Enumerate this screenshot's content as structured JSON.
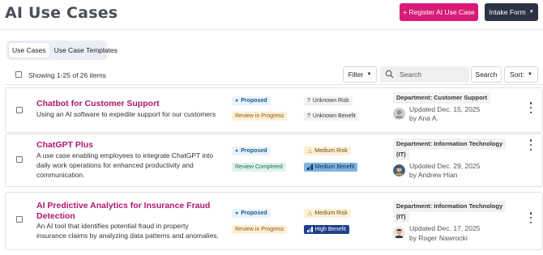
{
  "page": {
    "title": "AI Use Cases",
    "register_label": "+ Register AI Use Case",
    "intake_label": "Intake Form"
  },
  "tabs": [
    "Use Cases",
    "Use Case Templates"
  ],
  "toolbar": {
    "showing": "Showing 1-25 of 26 items",
    "filter_label": "Filter",
    "search_placeholder": "Search",
    "search_button": "Search",
    "sort_label": "Sort:"
  },
  "rows": [
    {
      "title": "Chatbot for Customer Support",
      "description": "Using an AI software to expedite support for our customers",
      "status": "Proposed",
      "stage": "Review in Progress",
      "risk": "Unknown Risk",
      "benefit": "Unknown Benefit",
      "department": "Department: Customer Support",
      "updated": "Updated Dec. 15, 2025",
      "by": "by Ana A."
    },
    {
      "title": "ChatGPT Plus",
      "description": [
        "A use case enabling employees to integrate ChatGPT into",
        "daily work operations for enhanced productivity and",
        "communication."
      ],
      "status": "Proposed",
      "stage": "Review Completed",
      "risk": "Medium Risk",
      "benefit": "Medium Benefit",
      "department": [
        "Department: Information Technology",
        "(IT)"
      ],
      "updated": "Updated Dec. 29, 2025",
      "by": "by Andrew Hian"
    },
    {
      "title": [
        "AI Predictive Analytics for Insurance Fraud",
        "Detection"
      ],
      "description": [
        "An AI tool that identifies potential fraud in property",
        "insurance claims by analyzing data patterns and anomalies."
      ],
      "status": "Proposed",
      "stage": "Review in Progress",
      "risk": "Medium Risk",
      "benefit": "High Benefit",
      "department": [
        "Department: Information Technology",
        "(IT)"
      ],
      "updated": "Updated Dec. 17, 2025",
      "by": "by Roger Nawrocki"
    }
  ],
  "icons": {
    "unknown": "question-circle-icon",
    "warning": "warning-triangle-icon",
    "benefit": "signal-bars-icon"
  },
  "colors": {
    "brand": "#d81b77",
    "title": "#b0176e",
    "dark": "#2c3444"
  }
}
